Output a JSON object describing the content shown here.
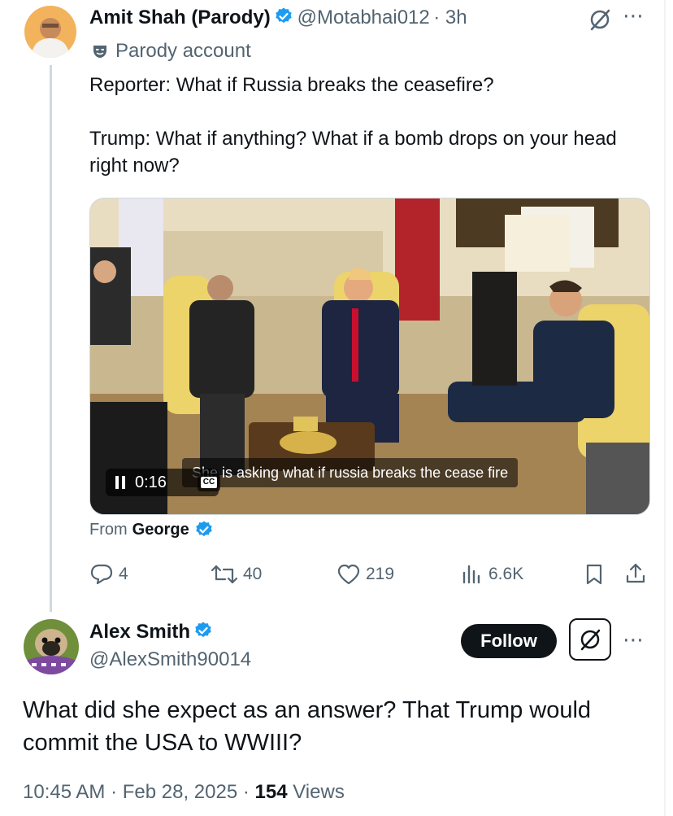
{
  "tweet": {
    "author_name": "Amit Shah (Parody)",
    "handle": "@Motabhai012",
    "time": "· 3h",
    "parody_label": "Parody account",
    "text": "Reporter: What if Russia breaks the ceasefire?\n\nTrump: What if anything? What if a bomb drops on your head right now?",
    "video": {
      "time": "0:16",
      "caption": "She is asking what if russia breaks the cease fire",
      "cc": "CC"
    },
    "from_prefix": "From",
    "from_name": "George",
    "actions": {
      "replies": "4",
      "reposts": "40",
      "likes": "219",
      "views": "6.6K"
    }
  },
  "reply": {
    "author_name": "Alex Smith",
    "handle": "@AlexSmith90014",
    "follow_label": "Follow",
    "text": "What did she expect as an answer? That Trump would commit the USA to WWIII?",
    "timestamp": "10:45 AM · Feb 28, 2025 · ",
    "views_count": "154",
    "views_label": " Views"
  },
  "colors": {
    "verified": "#1d9bf0",
    "secondary_text": "#536471",
    "thread_line": "#cfd9de"
  }
}
